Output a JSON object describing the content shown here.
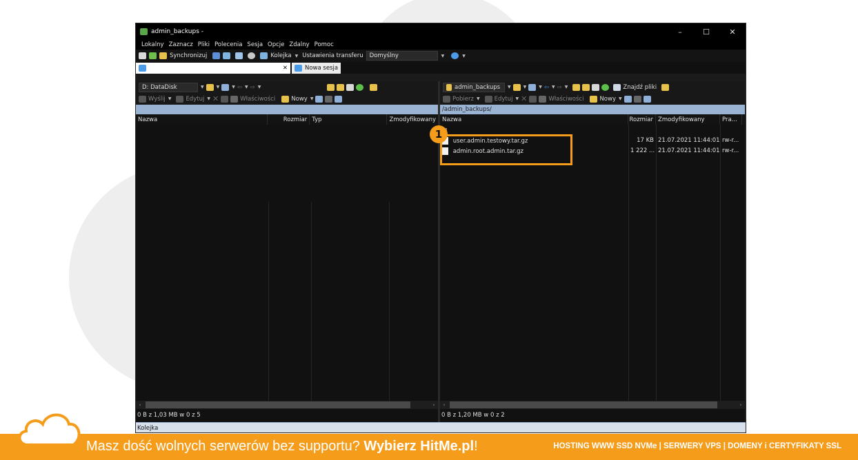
{
  "window": {
    "title": "admin_backups -",
    "controls": [
      "–",
      "☐",
      "✕"
    ]
  },
  "menu": [
    "Lokalny",
    "Zaznacz",
    "Pliki",
    "Polecenia",
    "Sesja",
    "Opcje",
    "Zdalny",
    "Pomoc"
  ],
  "toolbar": {
    "sync_label": "Synchronizuj",
    "queue_label": "Kolejka",
    "transfer_settings_label": "Ustawienia transferu",
    "transfer_preset": "Domyślny"
  },
  "tabs": {
    "current_close": "✕",
    "new_session_label": "Nowa sesja"
  },
  "left_pane": {
    "drive": "D: DataDisk",
    "upload_label": "Wyślij",
    "edit_label": "Edytuj",
    "properties_label": "Właściwości",
    "new_label": "Nowy",
    "path": "",
    "columns": [
      "Nazwa",
      "Rozmiar",
      "Typ",
      "Zmodyfikowany"
    ],
    "status": "0 B z 1,03 MB w 0 z 5"
  },
  "right_pane": {
    "folder": "admin_backups",
    "find_files_label": "Znajdź pliki",
    "download_label": "Pobierz",
    "edit_label": "Edytuj",
    "properties_label": "Właściwości",
    "new_label": "Nowy",
    "path": "/admin_backups/",
    "columns": [
      "Nazwa",
      "Rozmiar",
      "Zmodyfikowany",
      "Pra..."
    ],
    "rows": [
      {
        "name": "user.admin.testowy.tar.gz",
        "size": "17 KB",
        "modified": "21.07.2021 11:44:01",
        "rights": "rw-r..."
      },
      {
        "name": "admin.root.admin.tar.gz",
        "size": "1 222 ...",
        "modified": "21.07.2021 11:44:01",
        "rights": "rw-r..."
      }
    ],
    "status": "0 B z 1,20 MB w 0 z 2"
  },
  "queue_label": "Kolejka",
  "annotation": {
    "badge": "1",
    "color": "#f59c1a"
  },
  "banner": {
    "slogan_pre": "Masz dość wolnych serwerów bez supportu?",
    "slogan_bold": "Wybierz HitMe.pl",
    "slogan_post": "!",
    "right_text": "HOSTING WWW SSD NVMe | SERWERY VPS | DOMENY i CERTYFIKATY SSL",
    "color": "#f59c1a"
  }
}
